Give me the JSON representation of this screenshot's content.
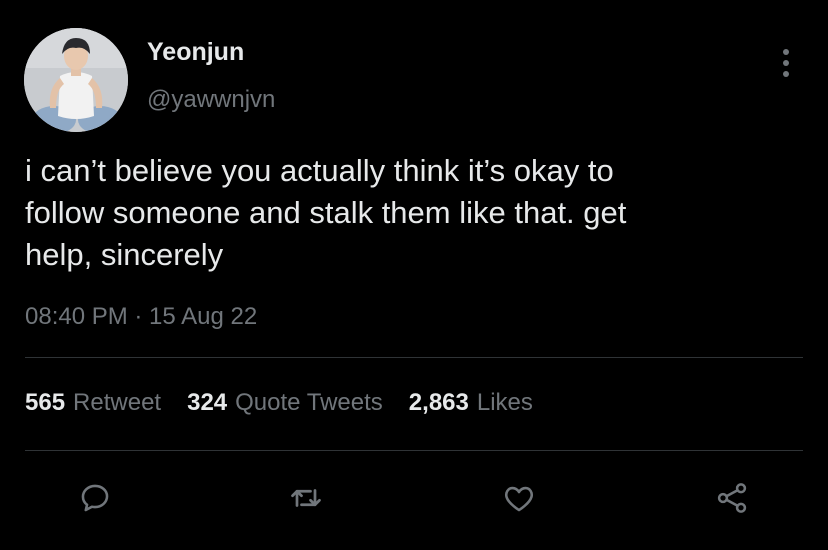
{
  "user": {
    "display_name": "Yeonjun",
    "handle": "@yawwnjvn"
  },
  "tweet": {
    "lines": [
      "i can’t believe you actually think it’s okay to",
      "follow someone and stalk them like that. get",
      "help, sincerely"
    ],
    "timestamp": "08:40 PM · 15 Aug 22"
  },
  "stats": {
    "retweets_count": "565",
    "retweets_label": "Retweet",
    "quotes_count": "324",
    "quotes_label": "Quote Tweets",
    "likes_count": "2,863",
    "likes_label": "Likes"
  },
  "actions": [
    "reply-icon",
    "retweet-icon",
    "like-icon",
    "share-icon"
  ],
  "colors": {
    "background": "#000000",
    "text_primary": "#e7e9ea",
    "text_secondary": "#71767b",
    "divider": "#2f3336"
  }
}
